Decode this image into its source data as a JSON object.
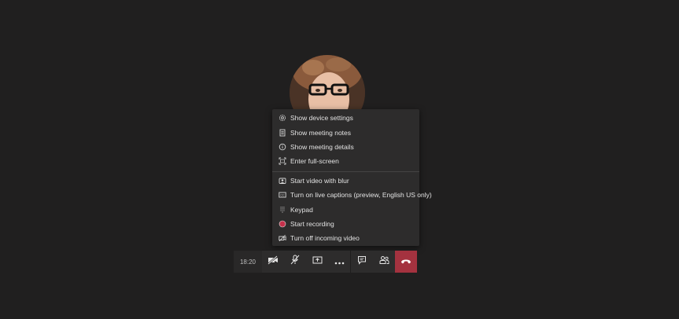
{
  "menu": {
    "items": [
      {
        "label": "Show device settings",
        "icon": "gear-icon"
      },
      {
        "label": "Show meeting notes",
        "icon": "notes-icon"
      },
      {
        "label": "Show meeting details",
        "icon": "info-icon"
      },
      {
        "label": "Enter full-screen",
        "icon": "fullscreen-icon"
      },
      {
        "label": "Start video with blur",
        "icon": "blur-icon"
      },
      {
        "label": "Turn on live captions (preview, English US only)",
        "icon": "captions-icon"
      },
      {
        "label": "Keypad",
        "icon": "keypad-icon"
      },
      {
        "label": "Start recording",
        "icon": "record-icon"
      },
      {
        "label": "Turn off incoming video",
        "icon": "video-off-icon"
      }
    ]
  },
  "toolbar": {
    "time": "18:20"
  },
  "colors": {
    "background": "#201f1f",
    "menu_bg": "#2d2c2c",
    "hangup": "#a4323f",
    "record": "#c4314b"
  }
}
